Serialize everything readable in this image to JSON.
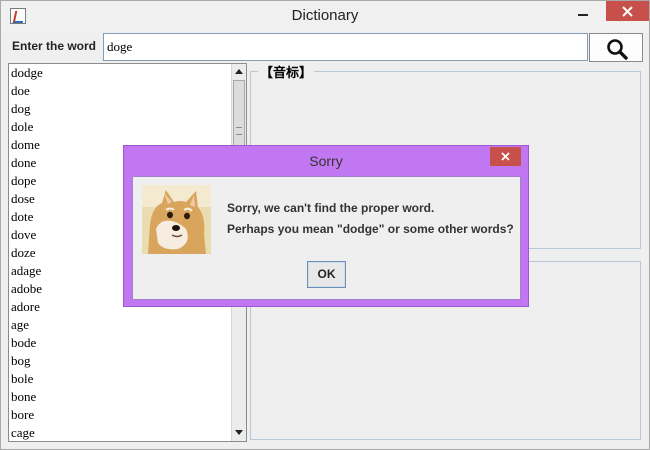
{
  "window": {
    "title": "Dictionary",
    "app_icon": "java-cup-icon",
    "controls": [
      "minimize-icon",
      "maximize-icon",
      "close-icon"
    ]
  },
  "search": {
    "label": "Enter the word",
    "value": "doge",
    "button_icon": "magnifier-icon"
  },
  "word_list": {
    "items": [
      "dodge",
      "doe",
      "dog",
      "dole",
      "dome",
      "done",
      "dope",
      "dose",
      "dote",
      "dove",
      "doze",
      "adage",
      "adobe",
      "adore",
      "age",
      "bode",
      "bog",
      "bole",
      "bone",
      "bore",
      "cage"
    ]
  },
  "phonetic_panel": {
    "legend": "【音标】"
  },
  "dialog": {
    "title": "Sorry",
    "image": "doge-dog-picture",
    "message_line1": "Sorry, we can't find the proper word.",
    "message_line2": "Perhaps you mean \"dodge\" or some other words?",
    "ok_label": "OK"
  },
  "colors": {
    "dialog_frame": "#c277f2",
    "close_button": "#c7504a"
  }
}
